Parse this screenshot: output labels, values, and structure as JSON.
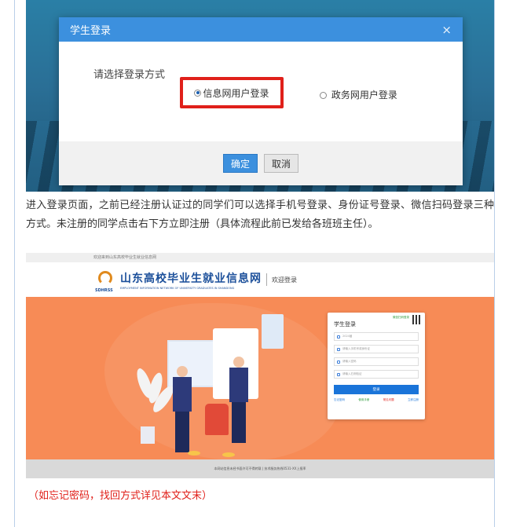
{
  "dialog": {
    "title": "学生登录",
    "close_glyph": "×",
    "prompt": "请选择登录方式",
    "options": [
      {
        "label": "信息网用户登录",
        "selected": true
      },
      {
        "label": "政务网用户登录",
        "selected": false
      }
    ],
    "confirm_label": "确定",
    "cancel_label": "取消"
  },
  "paragraph": "进入登录页面，之前已经注册认证过的同学们可以选择手机号登录、身份证号登录、微信扫码登录三种方式。未注册的同学点击右下方立即注册（具体流程此前已发给各班班主任）。",
  "site": {
    "top_welcome": "欢迎来到山东高校毕业生就业信息网",
    "logo_abbr": "SDHRSS",
    "title": "山东高校毕业生就业信息网",
    "subtitle": "EMPLOYMENT INFORMATION NETWORK OF UNIVERSITY GRADUATES IN SHANDONG",
    "welcome_login": "欢迎登录",
    "login": {
      "title": "学生登录",
      "qr_tag": "微信扫码登录",
      "year": "2024届",
      "phone_placeholder": "请输入手机号或身份证",
      "password_placeholder": "请输入密码",
      "captcha_placeholder": "请输入右侧验证",
      "button": "登录",
      "links": [
        "忘记密码",
        "使用手册",
        "常见问题",
        "立即注册"
      ]
    },
    "footer": "本网站信息未经书面许可不得转载 | 技术服务热线0531-XX上报率"
  },
  "note": "（如忘记密码，找回方式详见本文文末）",
  "colors": {
    "dialog_header": "#3c90de",
    "highlight_box": "#e0201a",
    "hero_orange": "#f78b56",
    "login_button": "#1a74d9",
    "note_red": "#e0201a"
  }
}
